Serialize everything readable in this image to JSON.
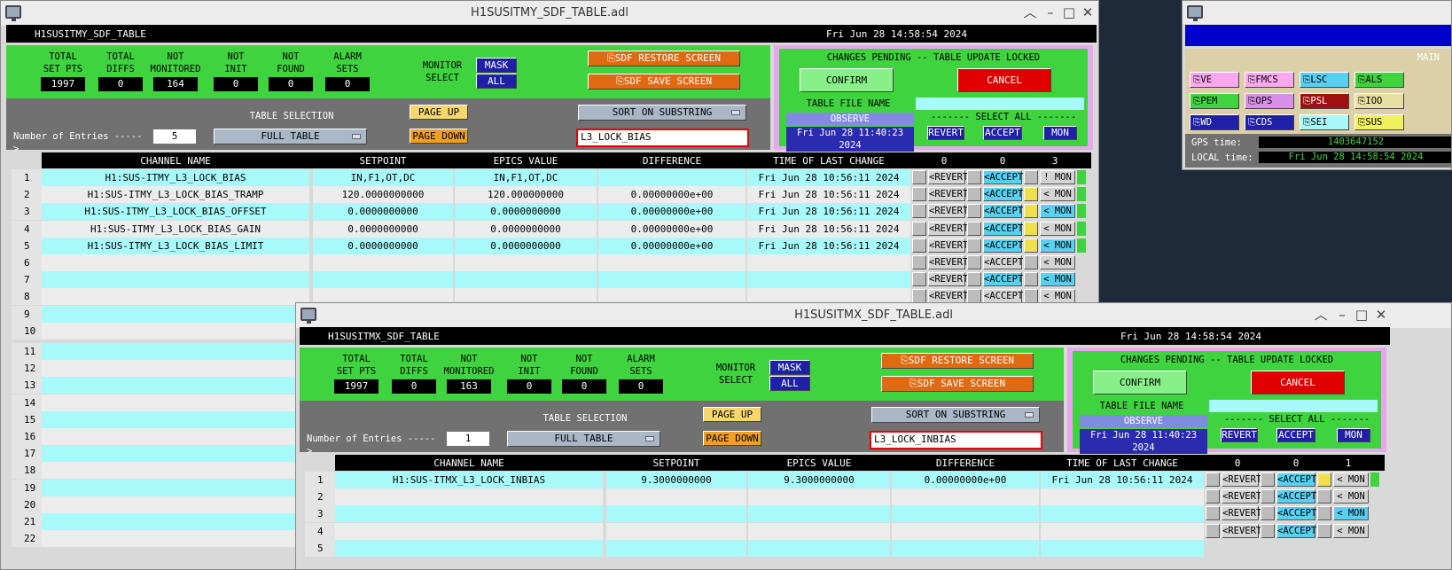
{
  "top_window": {
    "title": "H1SUSITMY_SDF_TABLE.adl",
    "header_name": "H1SUSITMY_SDF_TABLE",
    "header_time": "Fri Jun 28 14:58:54 2024",
    "stats": [
      {
        "label1": "TOTAL",
        "label2": "SET PTS",
        "value": "1997"
      },
      {
        "label1": "TOTAL",
        "label2": "DIFFS",
        "value": "0"
      },
      {
        "label1": "NOT",
        "label2": "MONITORED",
        "value": "164"
      },
      {
        "label1": "NOT",
        "label2": "INIT",
        "value": "0"
      },
      {
        "label1": "NOT",
        "label2": "FOUND",
        "value": "0"
      },
      {
        "label1": "ALARM",
        "label2": "SETS",
        "value": "0"
      }
    ],
    "monitor_select_1": "MONITOR",
    "monitor_select_2": "SELECT",
    "mask_label": "MASK",
    "all_label": "ALL",
    "restore_label": "SDF RESTORE SCREEN",
    "save_label": "SDF SAVE SCREEN",
    "pending_label": "CHANGES PENDING -- TABLE UPDATE LOCKED",
    "confirm_label": "CONFIRM",
    "cancel_label": "CANCEL",
    "table_file_label": "TABLE FILE NAME",
    "observe_label": "OBSERVE",
    "file_time": "Fri Jun 28 11:40:23 2024",
    "select_all_label": "------- SELECT ALL -------",
    "revert_all": "REVERT",
    "accept_all": "ACCEPT",
    "mon_all": "MON",
    "table_selection_label": "TABLE SELECTION",
    "entries_label": "Number of Entries ----->",
    "entries_value": "5",
    "full_table_label": "FULL TABLE",
    "page_up": "PAGE UP",
    "page_down": "PAGE DOWN",
    "sort_label": "SORT ON SUBSTRING",
    "search_value": "L3_LOCK_BIAS",
    "columns": {
      "channel": "CHANNEL NAME",
      "setpoint": "SETPOINT",
      "epics": "EPICS VALUE",
      "diff": "DIFFERENCE",
      "time": "TIME OF LAST CHANGE",
      "c1": "0",
      "c2": "0",
      "c3": "3"
    },
    "rows": [
      {
        "n": "1",
        "channel": "H1:SUS-ITMY_L3_LOCK_BIAS",
        "setpoint": "IN,F1,OT,DC",
        "epics": "IN,F1,OT,DC",
        "diff": "",
        "time": "Fri Jun 28 10:56:11 2024",
        "mon": "! MON"
      },
      {
        "n": "2",
        "channel": "H1:SUS-ITMY_L3_LOCK_BIAS_TRAMP",
        "setpoint": "120.0000000000",
        "epics": "120.000000000",
        "diff": "0.00000000e+00",
        "time": "Fri Jun 28 10:56:11 2024",
        "mon": "< MON"
      },
      {
        "n": "3",
        "channel": "H1:SUS-ITMY_L3_LOCK_BIAS_OFFSET",
        "setpoint": "0.0000000000",
        "epics": "0.0000000000",
        "diff": "0.00000000e+00",
        "time": "Fri Jun 28 10:56:11 2024",
        "mon": "< MON"
      },
      {
        "n": "4",
        "channel": "H1:SUS-ITMY_L3_LOCK_BIAS_GAIN",
        "setpoint": "0.0000000000",
        "epics": "0.0000000000",
        "diff": "0.00000000e+00",
        "time": "Fri Jun 28 10:56:11 2024",
        "mon": "< MON"
      },
      {
        "n": "5",
        "channel": "H1:SUS-ITMY_L3_LOCK_BIAS_LIMIT",
        "setpoint": "0.0000000000",
        "epics": "0.0000000000",
        "diff": "0.00000000e+00",
        "time": "Fri Jun 28 10:56:11 2024",
        "mon": "< MON"
      },
      {
        "n": "6",
        "channel": "",
        "setpoint": "",
        "epics": "",
        "diff": "",
        "time": "",
        "mon": "< MON"
      },
      {
        "n": "7",
        "channel": "",
        "setpoint": "",
        "epics": "",
        "diff": "",
        "time": "",
        "mon": "< MON"
      },
      {
        "n": "8",
        "channel": "",
        "setpoint": "",
        "epics": "",
        "diff": "",
        "time": "",
        "mon": "< MON"
      },
      {
        "n": "9",
        "channel": "",
        "setpoint": "",
        "epics": "",
        "diff": "",
        "time": "",
        "mon": ""
      },
      {
        "n": "10",
        "channel": "",
        "setpoint": "",
        "epics": "",
        "diff": "",
        "time": "",
        "mon": ""
      },
      {
        "n": "11",
        "channel": "",
        "setpoint": "",
        "epics": "",
        "diff": "",
        "time": "",
        "mon": ""
      },
      {
        "n": "12",
        "channel": "",
        "setpoint": "",
        "epics": "",
        "diff": "",
        "time": "",
        "mon": ""
      },
      {
        "n": "13",
        "channel": "",
        "setpoint": "",
        "epics": "",
        "diff": "",
        "time": "",
        "mon": ""
      },
      {
        "n": "14",
        "channel": "",
        "setpoint": "",
        "epics": "",
        "diff": "",
        "time": "",
        "mon": ""
      },
      {
        "n": "15",
        "channel": "",
        "setpoint": "",
        "epics": "",
        "diff": "",
        "time": "",
        "mon": ""
      },
      {
        "n": "16",
        "channel": "",
        "setpoint": "",
        "epics": "",
        "diff": "",
        "time": "",
        "mon": ""
      },
      {
        "n": "17",
        "channel": "",
        "setpoint": "",
        "epics": "",
        "diff": "",
        "time": "",
        "mon": ""
      },
      {
        "n": "18",
        "channel": "",
        "setpoint": "",
        "epics": "",
        "diff": "",
        "time": "",
        "mon": ""
      },
      {
        "n": "19",
        "channel": "",
        "setpoint": "",
        "epics": "",
        "diff": "",
        "time": "",
        "mon": ""
      },
      {
        "n": "20",
        "channel": "",
        "setpoint": "",
        "epics": "",
        "diff": "",
        "time": "",
        "mon": ""
      },
      {
        "n": "21",
        "channel": "",
        "setpoint": "",
        "epics": "",
        "diff": "",
        "time": "",
        "mon": ""
      },
      {
        "n": "22",
        "channel": "",
        "setpoint": "",
        "epics": "",
        "diff": "",
        "time": "",
        "mon": ""
      }
    ],
    "revert_label": "<REVERT",
    "accept_label": "<ACCEPT"
  },
  "bottom_window": {
    "title": "H1SUSITMX_SDF_TABLE.adl",
    "header_name": "H1SUSITMX_SDF_TABLE",
    "header_time": "Fri Jun 28 14:58:54 2024",
    "stats": [
      {
        "label1": "TOTAL",
        "label2": "SET PTS",
        "value": "1997"
      },
      {
        "label1": "TOTAL",
        "label2": "DIFFS",
        "value": "0"
      },
      {
        "label1": "NOT",
        "label2": "MONITORED",
        "value": "163"
      },
      {
        "label1": "NOT",
        "label2": "INIT",
        "value": "0"
      },
      {
        "label1": "NOT",
        "label2": "FOUND",
        "value": "0"
      },
      {
        "label1": "ALARM",
        "label2": "SETS",
        "value": "0"
      }
    ],
    "entries_value": "1",
    "search_value": "L3_LOCK_INBIAS",
    "columns": {
      "c3": "1"
    },
    "rows": [
      {
        "n": "1",
        "channel": "H1:SUS-ITMX_L3_LOCK_INBIAS",
        "setpoint": "9.3000000000",
        "epics": "9.3000000000",
        "diff": "0.00000000e+00",
        "time": "Fri Jun 28 10:56:11 2024",
        "mon": "< MON"
      },
      {
        "n": "2",
        "channel": "",
        "setpoint": "",
        "epics": "",
        "diff": "",
        "time": "",
        "mon": "< MON"
      },
      {
        "n": "3",
        "channel": "",
        "setpoint": "",
        "epics": "",
        "diff": "",
        "time": "",
        "mon": "< MON"
      },
      {
        "n": "4",
        "channel": "",
        "setpoint": "",
        "epics": "",
        "diff": "",
        "time": "",
        "mon": "< MON"
      },
      {
        "n": "5",
        "channel": "",
        "setpoint": "",
        "epics": "",
        "diff": "",
        "time": "",
        "mon": ""
      }
    ]
  },
  "main_window": {
    "main_label": "MAIN",
    "buttons": [
      {
        "label": "VE",
        "color": "#f9a8f0"
      },
      {
        "label": "FMCS",
        "color": "#f9a8f0"
      },
      {
        "label": "LSC",
        "color": "#58d0f0"
      },
      {
        "label": "ALS",
        "color": "#3fd43f"
      },
      {
        "label": "PEM",
        "color": "#3fd43f"
      },
      {
        "label": "OPS",
        "color": "#d890e8"
      },
      {
        "label": "PSL",
        "color": "#a01010"
      },
      {
        "label": "IOO",
        "color": "#e8e0a0"
      },
      {
        "label": "WD",
        "color": "#1f1fa8"
      },
      {
        "label": "CDS",
        "color": "#1f1fa8"
      },
      {
        "label": "SEI",
        "color": "#a8f8f8"
      },
      {
        "label": "SUS",
        "color": "#f0f060"
      }
    ],
    "gps_label": "GPS time:",
    "gps_value": "1403647152",
    "local_label": "LOCAL time:",
    "local_value": "Fri Jun 28 14:58:54 2024"
  },
  "colors": {
    "cyan_row": "#a8fafa",
    "light_row": "#ececec",
    "panel_green": "#3fd43f",
    "orange": "#e06a12",
    "navy": "#1f1fa8"
  }
}
